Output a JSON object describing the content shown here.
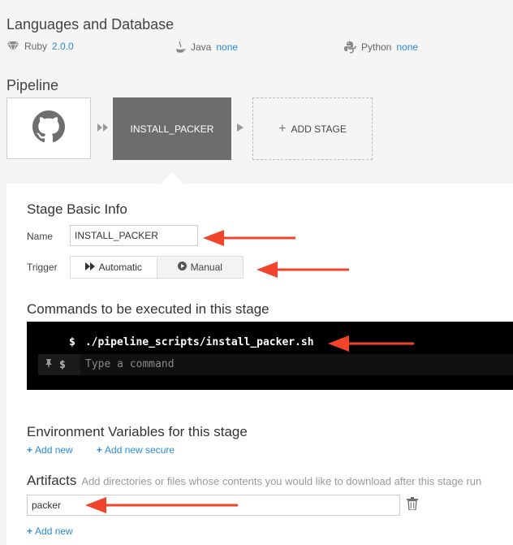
{
  "languages": {
    "title": "Languages and Database",
    "items": [
      {
        "name": "Ruby",
        "value": "2.0.0",
        "icon": "ruby-icon"
      },
      {
        "name": "Java",
        "value": "none",
        "icon": "java-icon"
      },
      {
        "name": "Python",
        "value": "none",
        "icon": "python-icon"
      }
    ]
  },
  "pipeline": {
    "title": "Pipeline",
    "source_icon": "github-icon",
    "stage_label": "INSTALL_PACKER",
    "add_stage_label": "ADD STAGE"
  },
  "stage_info": {
    "title": "Stage Basic Info",
    "name_label": "Name",
    "name_value": "INSTALL_PACKER",
    "trigger_label": "Trigger",
    "trigger_auto": "Automatic",
    "trigger_manual": "Manual"
  },
  "commands": {
    "title": "Commands to be executed in this stage",
    "prompt": "$",
    "command": "./pipeline_scripts/install_packer.sh",
    "placeholder": "Type a command"
  },
  "env": {
    "title": "Environment Variables for this stage",
    "add_new": "Add new",
    "add_new_secure": "Add new secure"
  },
  "artifacts": {
    "title": "Artifacts",
    "hint": "Add directories or files whose contents you would like to download after this stage run",
    "value": "packer",
    "add_new": "Add new"
  },
  "colors": {
    "accent": "#2a8ad6",
    "stage": "#6d6d6d",
    "annotation_arrow": "#f0452a"
  }
}
